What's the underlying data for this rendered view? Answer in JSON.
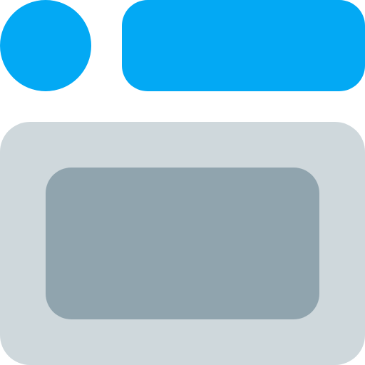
{
  "icon": {
    "name": "window-layout-icon",
    "colors": {
      "accent": "#03A9F4",
      "frame": "#CFD8DC",
      "content": "#90A4AE",
      "background": "#FFFFFF"
    }
  }
}
